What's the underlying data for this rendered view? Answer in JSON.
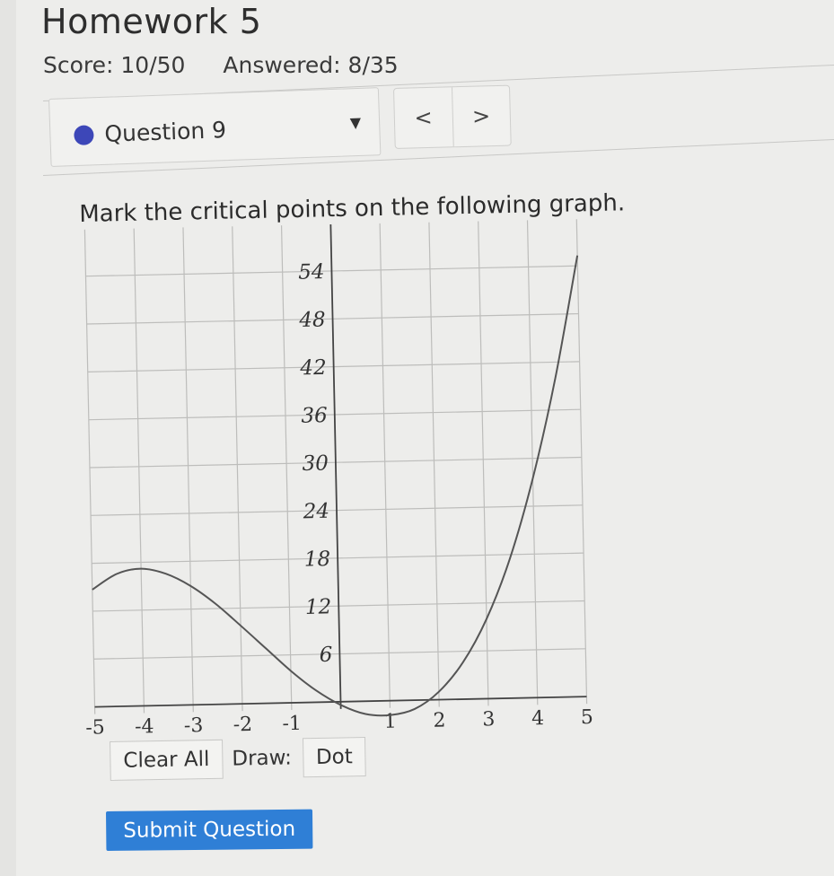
{
  "header": {
    "title": "Homework 5",
    "score": "Score: 10/50",
    "answered": "Answered: 8/35"
  },
  "question_nav": {
    "label": "Question 9",
    "prev": "<",
    "next": ">"
  },
  "prompt": "Mark the critical points on the following graph.",
  "tools": {
    "clear_all": "Clear All",
    "draw_label": "Draw:",
    "dot": "Dot"
  },
  "submit": "Submit Question",
  "chart_data": {
    "type": "line",
    "x_ticks": [
      "-5",
      "-4",
      "-3",
      "-2",
      "-1",
      "1",
      "2",
      "3",
      "4",
      "5"
    ],
    "y_ticks": [
      "6",
      "12",
      "18",
      "24",
      "30",
      "36",
      "42",
      "48",
      "54"
    ],
    "xlim": [
      -5,
      5
    ],
    "ylim": [
      0,
      54
    ],
    "grid": true,
    "series": [
      {
        "x": [
          -5,
          -4.5,
          -4,
          -3.5,
          -3,
          -2.5,
          -2,
          -1.5,
          -1,
          -0.5,
          0,
          0.5,
          1,
          1.5,
          2,
          2.5,
          3,
          3.5,
          4,
          4.5,
          5
        ],
        "y": [
          14.7,
          16.6,
          17.2,
          16.5,
          14.9,
          12.6,
          9.8,
          6.9,
          4.0,
          1.5,
          -0.4,
          -1.6,
          -1.8,
          -1.1,
          1.0,
          4.6,
          10.0,
          17.5,
          27.5,
          40.0,
          55.3
        ]
      }
    ]
  }
}
